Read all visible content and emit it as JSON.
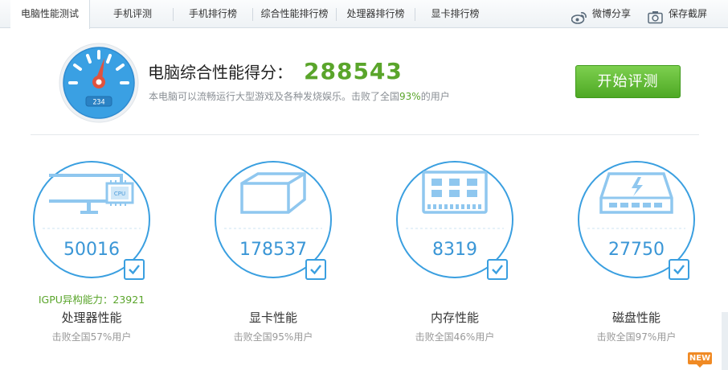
{
  "tabs": [
    {
      "label": "电脑性能测试",
      "active": true
    },
    {
      "label": "手机评测",
      "active": false
    },
    {
      "label": "手机排行榜",
      "active": false
    },
    {
      "label": "综合性能排行榜",
      "active": false
    },
    {
      "label": "处理器排行榜",
      "active": false
    },
    {
      "label": "显卡排行榜",
      "active": false
    }
  ],
  "toolbar": {
    "weibo_share": "微博分享",
    "save_screenshot": "保存截屏",
    "weibo_icon": "weibo-icon",
    "camera_icon": "camera-icon"
  },
  "summary": {
    "gauge_readout": "234",
    "title": "电脑综合性能得分：",
    "score": "288543",
    "desc_before": "本电脑可以流畅运行大型游戏及各种发烧娱乐。击败了全国",
    "desc_pct": "93%",
    "desc_after": "的用户",
    "start_button": "开始评测"
  },
  "cards": [
    {
      "id": "cpu",
      "score": "50016",
      "name": "处理器性能",
      "sub": "击败全国57%用户",
      "igpu": "IGPU异构能力：23921",
      "icon": "monitor-cpu-icon",
      "chip_label": "CPU"
    },
    {
      "id": "gpu",
      "score": "178537",
      "name": "显卡性能",
      "sub": "击败全国95%用户",
      "icon": "cube-icon"
    },
    {
      "id": "mem",
      "score": "8319",
      "name": "内存性能",
      "sub": "击败全国46%用户",
      "icon": "memory-icon"
    },
    {
      "id": "disk",
      "score": "27750",
      "name": "磁盘性能",
      "sub": "击败全国97%用户",
      "icon": "disk-icon"
    }
  ],
  "badge": {
    "new": "NEW"
  },
  "colors": {
    "accent_blue": "#3a9fe0",
    "score_green": "#5aa52b",
    "button_green": "#5bb52e",
    "badge_orange": "#f08a24"
  }
}
